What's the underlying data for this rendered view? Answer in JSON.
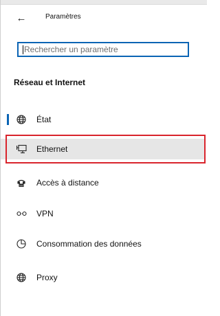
{
  "window": {
    "title": "Paramètres",
    "back_label": "←"
  },
  "search": {
    "placeholder": "Rechercher un paramètre",
    "value": ""
  },
  "section": {
    "heading": "Réseau et Internet"
  },
  "nav": {
    "items": [
      {
        "label": "État",
        "icon": "globe-icon"
      },
      {
        "label": "Ethernet",
        "icon": "monitor-network-icon"
      },
      {
        "label": "Accès à distance",
        "icon": "dialup-phone-icon"
      },
      {
        "label": "VPN",
        "icon": "vpn-icon"
      },
      {
        "label": "Consommation des données",
        "icon": "data-usage-icon"
      },
      {
        "label": "Proxy",
        "icon": "globe-icon"
      }
    ],
    "selected_index": 0,
    "highlighted_index": 1
  },
  "colors": {
    "accent": "#0a64b4",
    "highlight_border": "#d9232b",
    "hover_background": "#e6e6e6"
  }
}
